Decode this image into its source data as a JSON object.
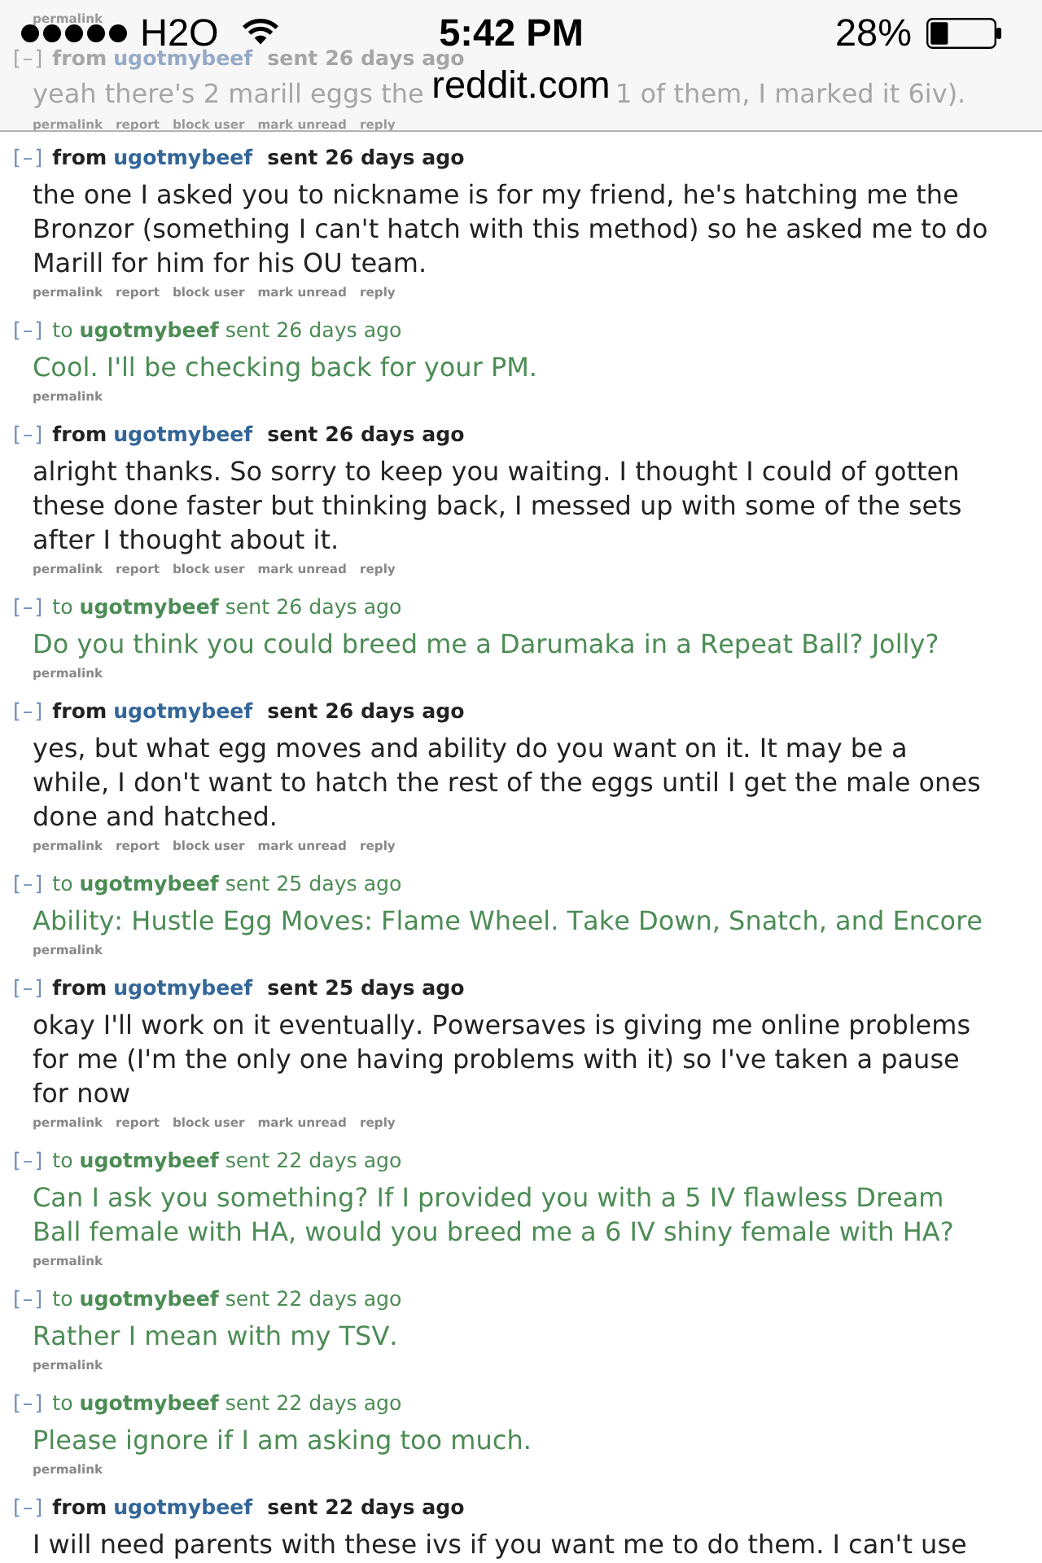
{
  "status_bar": {
    "carrier": "H2O",
    "time": "5:42 PM",
    "battery": "28%"
  },
  "address_bar": {
    "url": "reddit.com"
  },
  "faded_behind_bar": {
    "actions": [
      "permalink"
    ],
    "message": {
      "kind": "received",
      "toggle": "[–]",
      "direction": "from",
      "user": "ugotmybeef",
      "sent": "sent 26 days ago",
      "body_parts": [
        "yeah there's 2 marill eggs the",
        "1 of them, I marked it 6iv)."
      ],
      "actions": [
        "permalink",
        "report",
        "block user",
        "mark unread",
        "reply"
      ]
    }
  },
  "messages": [
    {
      "kind": "received",
      "toggle": "[–]",
      "direction": "from",
      "user": "ugotmybeef",
      "sent": "sent 26 days ago",
      "body": "the one I asked you to nickname is for my friend, he's hatching me the Bronzor (something I can't hatch with this method) so he asked me to do Marill for him for his OU team.",
      "actions": [
        "permalink",
        "report",
        "block user",
        "mark unread",
        "reply"
      ]
    },
    {
      "kind": "sent",
      "toggle": "[–]",
      "direction": "to",
      "user": "ugotmybeef",
      "sent": "sent 26 days ago",
      "body": "Cool. I'll be checking back for your PM.",
      "actions": [
        "permalink"
      ]
    },
    {
      "kind": "received",
      "toggle": "[–]",
      "direction": "from",
      "user": "ugotmybeef",
      "sent": "sent 26 days ago",
      "body": "alright thanks. So sorry to keep you waiting. I thought I could of gotten these done faster but thinking back, I messed up with some of the sets after I thought about it.",
      "actions": [
        "permalink",
        "report",
        "block user",
        "mark unread",
        "reply"
      ]
    },
    {
      "kind": "sent",
      "toggle": "[–]",
      "direction": "to",
      "user": "ugotmybeef",
      "sent": "sent 26 days ago",
      "body": "Do you think you could breed me a Darumaka in a Repeat Ball? Jolly?",
      "actions": [
        "permalink"
      ]
    },
    {
      "kind": "received",
      "toggle": "[–]",
      "direction": "from",
      "user": "ugotmybeef",
      "sent": "sent 26 days ago",
      "body": "yes, but what egg moves and ability do you want on it. It may be a while, I don't want to hatch the rest of the eggs until I get the male ones done and hatched.",
      "actions": [
        "permalink",
        "report",
        "block user",
        "mark unread",
        "reply"
      ]
    },
    {
      "kind": "sent",
      "toggle": "[–]",
      "direction": "to",
      "user": "ugotmybeef",
      "sent": "sent 25 days ago",
      "body": "Ability: Hustle Egg Moves: Flame Wheel. Take Down, Snatch, and Encore",
      "actions": [
        "permalink"
      ]
    },
    {
      "kind": "received",
      "toggle": "[–]",
      "direction": "from",
      "user": "ugotmybeef",
      "sent": "sent 25 days ago",
      "body": "okay I'll work on it eventually. Powersaves is giving me online problems for me (I'm the only one having problems with it) so I've taken a pause for now",
      "actions": [
        "permalink",
        "report",
        "block user",
        "mark unread",
        "reply"
      ]
    },
    {
      "kind": "sent",
      "toggle": "[–]",
      "direction": "to",
      "user": "ugotmybeef",
      "sent": "sent 22 days ago",
      "body": "Can I ask you something? If I provided you with a 5 IV flawless Dream Ball female with HA, would you breed me a 6 IV shiny female with HA?",
      "actions": [
        "permalink"
      ]
    },
    {
      "kind": "sent",
      "toggle": "[–]",
      "direction": "to",
      "user": "ugotmybeef",
      "sent": "sent 22 days ago",
      "body": "Rather I mean with my TSV.",
      "actions": [
        "permalink"
      ]
    },
    {
      "kind": "sent",
      "toggle": "[–]",
      "direction": "to",
      "user": "ugotmybeef",
      "sent": "sent 22 days ago",
      "body": "Please ignore if I am asking too much.",
      "actions": [
        "permalink"
      ]
    },
    {
      "kind": "received",
      "toggle": "[–]",
      "direction": "from",
      "user": "ugotmybeef",
      "sent": "sent 22 days ago",
      "body": "I will need parents with these ivs if you want me to do them. I can't use"
    }
  ]
}
